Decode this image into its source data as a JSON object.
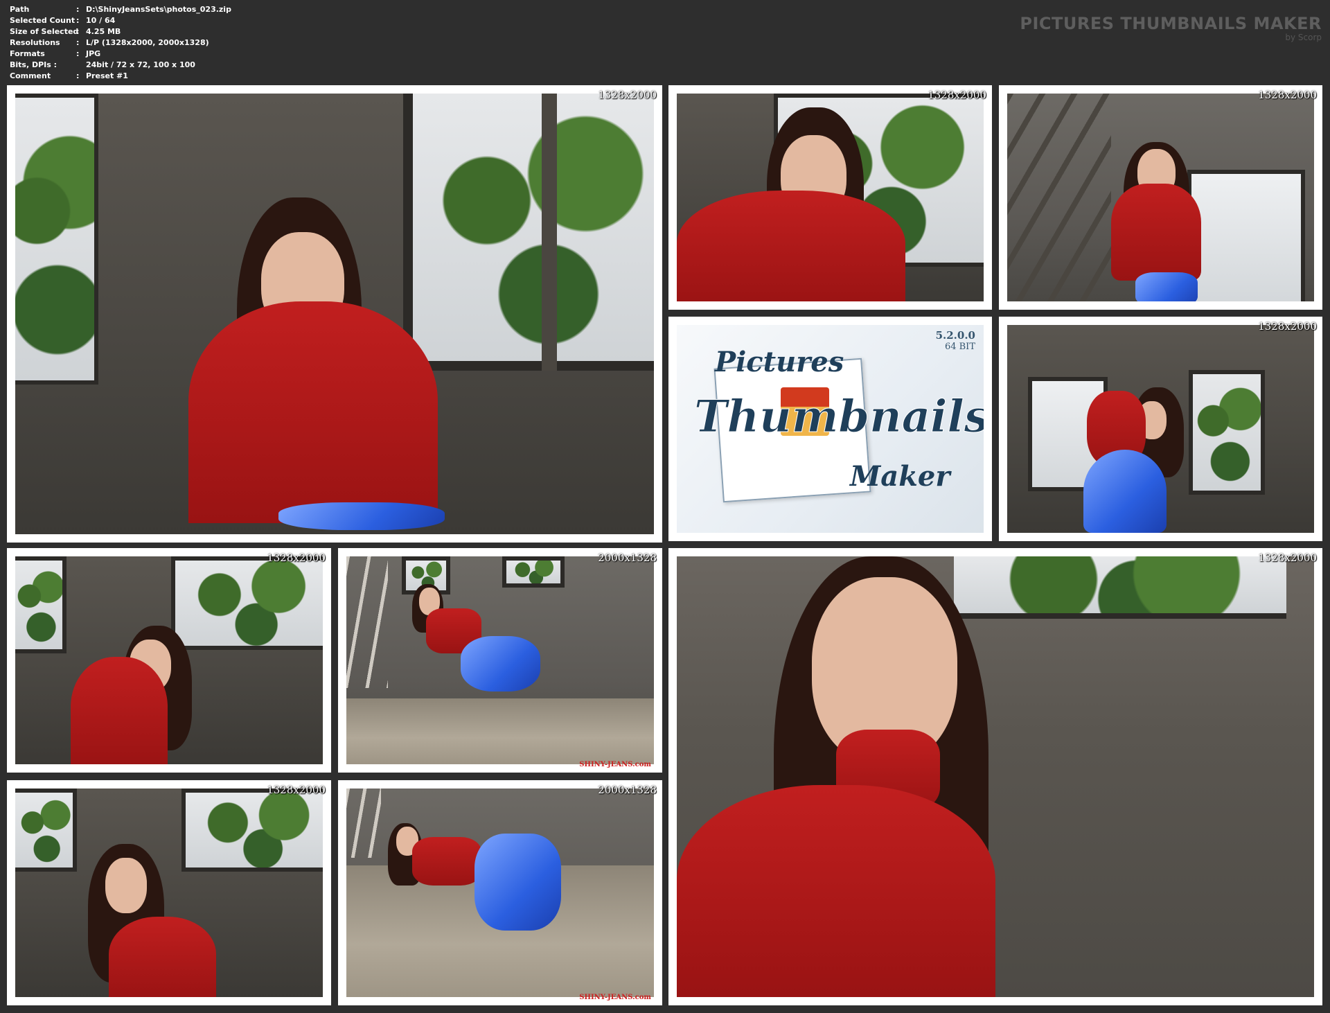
{
  "info": {
    "rows": [
      {
        "key": "Path",
        "sep": ":",
        "value": "D:\\ShinyJeansSets\\photos_023.zip"
      },
      {
        "key": "Selected Count",
        "sep": ":",
        "value": "10 / 64"
      },
      {
        "key": "Size of Selected",
        "sep": ":",
        "value": "4.25 MB"
      },
      {
        "key": "Resolutions",
        "sep": ":",
        "value": "L/P (1328x2000, 2000x1328)"
      },
      {
        "key": "Formats",
        "sep": ":",
        "value": "JPG"
      },
      {
        "key": "Bits, DPIs :",
        "sep": "",
        "value": "24bit / 72 x 72, 100 x 100"
      },
      {
        "key": "Comment",
        "sep": ":",
        "value": "Preset #1"
      }
    ]
  },
  "brand": {
    "title": "PICTURES THUMBNAILS MAKER",
    "subtitle": "by Scorp"
  },
  "logo": {
    "version": "5.2.0.0",
    "bits": "64 BIT",
    "word1": "Pictures",
    "word2": "Thumbnails",
    "word3": "Maker"
  },
  "thumbnails": [
    {
      "res": "1328x2000"
    },
    {
      "res": "1328x2000"
    },
    {
      "res": "1328x2000"
    },
    {
      "res": "1328x2000"
    },
    {
      "res": "1328x2000"
    },
    {
      "res": "2000x1328",
      "watermark": "SHINY-JEANS.com"
    },
    {
      "res": "1328x2000"
    },
    {
      "res": "1328x2000"
    },
    {
      "res": "2000x1328",
      "watermark": "SHINY-JEANS.com"
    }
  ],
  "colors": {
    "background": "#2e2e2e",
    "tile_border": "#ffffff",
    "top": "#c11f1f",
    "jeans": "#2b5fe0"
  }
}
